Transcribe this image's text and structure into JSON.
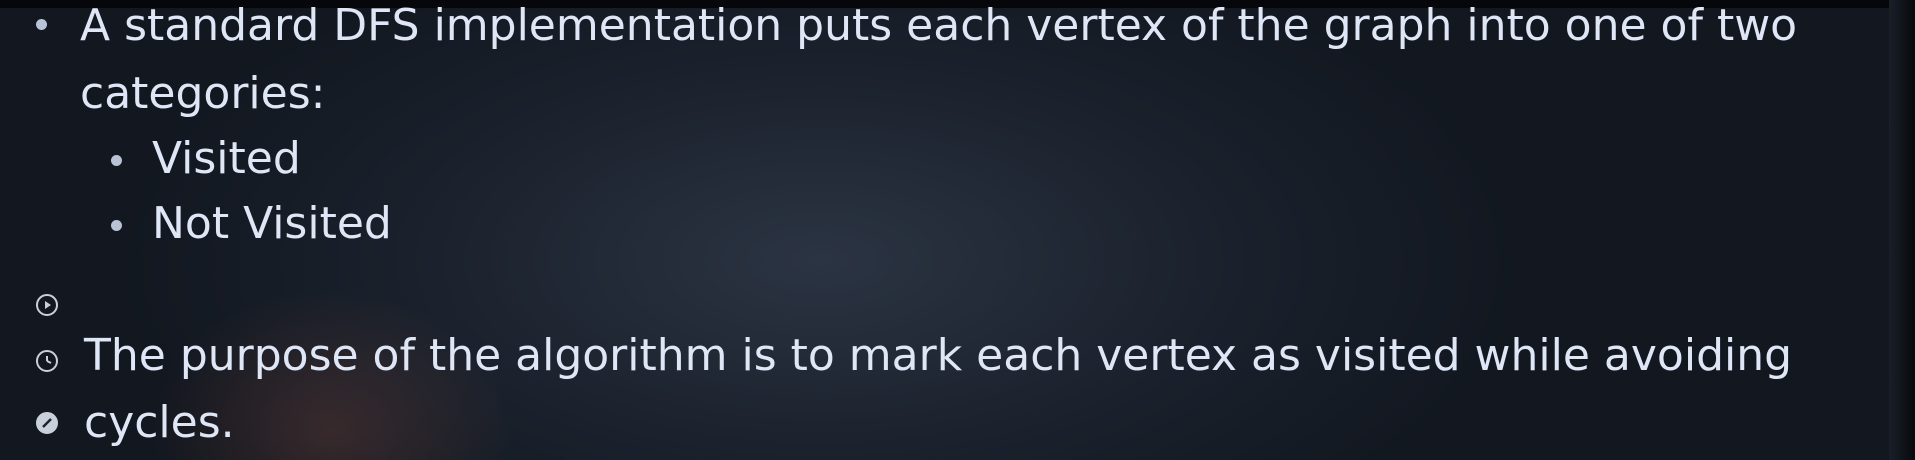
{
  "slide": {
    "bullet1_line1": "A standard DFS implementation puts each vertex of the graph into one of two",
    "bullet1_line2": "categories:",
    "sub1": "Visited",
    "sub2": "Not Visited",
    "bullet2_line1": "The purpose of the algorithm is to mark each vertex as visited while avoiding",
    "bullet2_line2": "cycles."
  },
  "icons": {
    "play": "play-icon",
    "timer": "timer-icon",
    "pen": "pen-icon"
  }
}
